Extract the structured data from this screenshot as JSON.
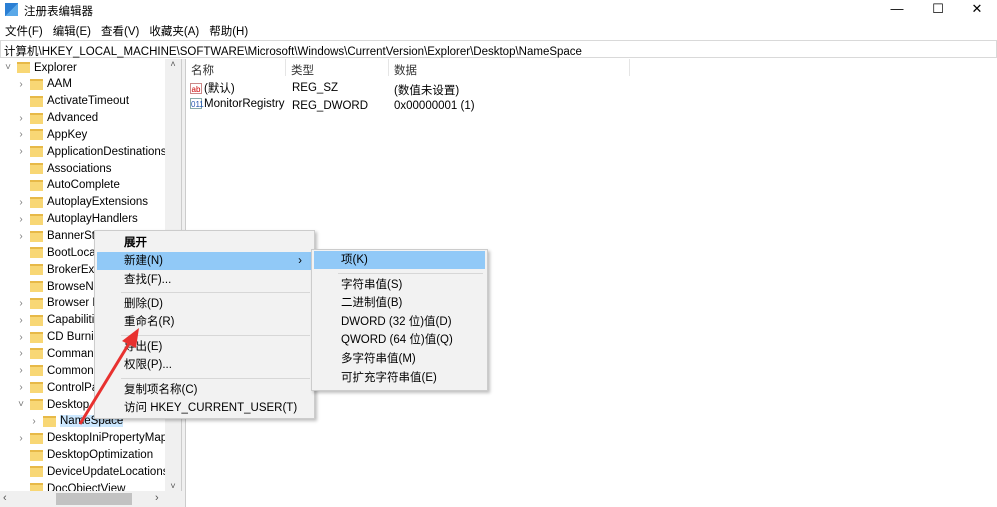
{
  "window": {
    "title": "注册表编辑器",
    "minimize": "—",
    "maximize": "☐",
    "close": "✕"
  },
  "menubar": [
    "文件(F)",
    "编辑(E)",
    "查看(V)",
    "收藏夹(A)",
    "帮助(H)"
  ],
  "address": "计算机\\HKEY_LOCAL_MACHINE\\SOFTWARE\\Microsoft\\Windows\\CurrentVersion\\Explorer\\Desktop\\NameSpace",
  "tree": [
    {
      "label": "Explorer",
      "chev": "˅",
      "indent": 0
    },
    {
      "label": "AAM",
      "chev": "›",
      "indent": 1
    },
    {
      "label": "ActivateTimeout",
      "chev": "",
      "indent": 1
    },
    {
      "label": "Advanced",
      "chev": "›",
      "indent": 1
    },
    {
      "label": "AppKey",
      "chev": "›",
      "indent": 1
    },
    {
      "label": "ApplicationDestinations",
      "chev": "›",
      "indent": 1
    },
    {
      "label": "Associations",
      "chev": "",
      "indent": 1
    },
    {
      "label": "AutoComplete",
      "chev": "",
      "indent": 1
    },
    {
      "label": "AutoplayExtensions",
      "chev": "›",
      "indent": 1
    },
    {
      "label": "AutoplayHandlers",
      "chev": "›",
      "indent": 1
    },
    {
      "label": "BannerStore",
      "chev": "›",
      "indent": 1
    },
    {
      "label": "BootLocale",
      "chev": "",
      "indent": 1
    },
    {
      "label": "BrokerExtensions",
      "chev": "",
      "indent": 1
    },
    {
      "label": "BrowseNewProcess",
      "chev": "",
      "indent": 1
    },
    {
      "label": "Browser Helper Objects",
      "chev": "›",
      "indent": 1
    },
    {
      "label": "Capabilities",
      "chev": "›",
      "indent": 1
    },
    {
      "label": "CD Burning",
      "chev": "›",
      "indent": 1
    },
    {
      "label": "CommandStore",
      "chev": "›",
      "indent": 1
    },
    {
      "label": "CommonPlaces",
      "chev": "›",
      "indent": 1
    },
    {
      "label": "ControlPanel",
      "chev": "›",
      "indent": 1
    },
    {
      "label": "Desktop",
      "chev": "˅",
      "indent": 1
    },
    {
      "label": "NameSpace",
      "chev": "›",
      "indent": 2,
      "selected": true
    },
    {
      "label": "DesktopIniPropertyMap",
      "chev": "›",
      "indent": 1
    },
    {
      "label": "DesktopOptimization",
      "chev": "",
      "indent": 1
    },
    {
      "label": "DeviceUpdateLocations",
      "chev": "",
      "indent": 1
    },
    {
      "label": "DocObjectView",
      "chev": "",
      "indent": 1
    }
  ],
  "list": {
    "headers": {
      "name": "名称",
      "type": "类型",
      "data": "数据"
    },
    "rows": [
      {
        "icon": "ab",
        "name": "(默认)",
        "type": "REG_SZ",
        "data": "(数值未设置)"
      },
      {
        "icon": "011",
        "name": "MonitorRegistry",
        "type": "REG_DWORD",
        "data": "0x00000001 (1)"
      }
    ]
  },
  "context_menu": {
    "items": [
      "展开",
      "新建(N)",
      "查找(F)...",
      "删除(D)",
      "重命名(R)",
      "导出(E)",
      "权限(P)...",
      "复制项名称(C)",
      "访问 HKEY_CURRENT_USER(T)"
    ],
    "submenu_arrow": "›"
  },
  "submenu": {
    "items": [
      "项(K)",
      "字符串值(S)",
      "二进制值(B)",
      "DWORD (32 位)值(D)",
      "QWORD (64 位)值(Q)",
      "多字符串值(M)",
      "可扩充字符串值(E)"
    ]
  },
  "colors": {
    "highlight": "#91c9f7",
    "arrow": "#e8312f"
  }
}
